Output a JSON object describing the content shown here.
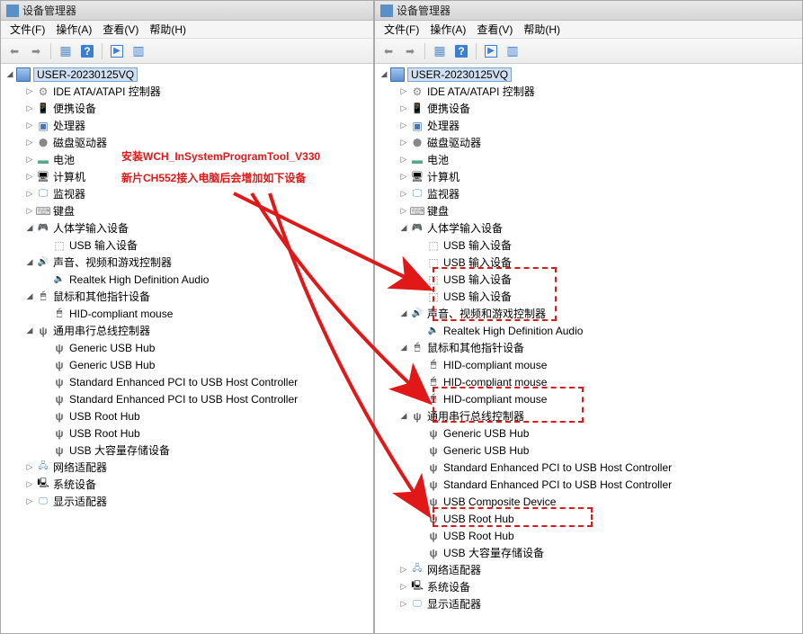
{
  "window_title": "设备管理器",
  "menu": {
    "file": "文件(F)",
    "action": "操作(A)",
    "view": "查看(V)",
    "help": "帮助(H)"
  },
  "root_name": "USER-20230125VQ",
  "annotation": {
    "line1": "安装WCH_InSystemProgramTool_V330",
    "line2": "新片CH552接入电脑后会增加如下设备"
  },
  "left_tree": [
    {
      "label": "IDE ATA/ATAPI 控制器",
      "icon": "ic-ide",
      "exp": "closed",
      "indent": 1
    },
    {
      "label": "便携设备",
      "icon": "ic-portable",
      "exp": "closed",
      "indent": 1
    },
    {
      "label": "处理器",
      "icon": "ic-cpu",
      "exp": "closed",
      "indent": 1
    },
    {
      "label": "磁盘驱动器",
      "icon": "ic-disk",
      "exp": "closed",
      "indent": 1
    },
    {
      "label": "电池",
      "icon": "ic-battery",
      "exp": "closed",
      "indent": 1
    },
    {
      "label": "计算机",
      "icon": "ic-pc",
      "exp": "closed",
      "indent": 1
    },
    {
      "label": "监视器",
      "icon": "ic-monitor",
      "exp": "closed",
      "indent": 1
    },
    {
      "label": "键盘",
      "icon": "ic-keyboard",
      "exp": "closed",
      "indent": 1
    },
    {
      "label": "人体学输入设备",
      "icon": "ic-hid",
      "exp": "open",
      "indent": 1
    },
    {
      "label": "USB 输入设备",
      "icon": "ic-usbinput",
      "exp": "none",
      "indent": 2
    },
    {
      "label": "声音、视频和游戏控制器",
      "icon": "ic-audio",
      "exp": "open",
      "indent": 1
    },
    {
      "label": "Realtek High Definition Audio",
      "icon": "ic-speaker",
      "exp": "none",
      "indent": 2
    },
    {
      "label": "鼠标和其他指针设备",
      "icon": "ic-mouse",
      "exp": "open",
      "indent": 1
    },
    {
      "label": "HID-compliant mouse",
      "icon": "ic-mouse",
      "exp": "none",
      "indent": 2
    },
    {
      "label": "通用串行总线控制器",
      "icon": "ic-usb",
      "exp": "open",
      "indent": 1
    },
    {
      "label": "Generic USB Hub",
      "icon": "ic-usb",
      "exp": "none",
      "indent": 2
    },
    {
      "label": "Generic USB Hub",
      "icon": "ic-usb",
      "exp": "none",
      "indent": 2
    },
    {
      "label": "Standard Enhanced PCI to USB Host Controller",
      "icon": "ic-usb",
      "exp": "none",
      "indent": 2
    },
    {
      "label": "Standard Enhanced PCI to USB Host Controller",
      "icon": "ic-usb",
      "exp": "none",
      "indent": 2
    },
    {
      "label": "USB Root Hub",
      "icon": "ic-usb",
      "exp": "none",
      "indent": 2
    },
    {
      "label": "USB Root Hub",
      "icon": "ic-usb",
      "exp": "none",
      "indent": 2
    },
    {
      "label": "USB 大容量存储设备",
      "icon": "ic-usb",
      "exp": "none",
      "indent": 2
    },
    {
      "label": "网络适配器",
      "icon": "ic-net",
      "exp": "closed",
      "indent": 1
    },
    {
      "label": "系统设备",
      "icon": "ic-sys",
      "exp": "closed",
      "indent": 1
    },
    {
      "label": "显示适配器",
      "icon": "ic-display",
      "exp": "closed",
      "indent": 1
    }
  ],
  "right_tree": [
    {
      "label": "IDE ATA/ATAPI 控制器",
      "icon": "ic-ide",
      "exp": "closed",
      "indent": 1
    },
    {
      "label": "便携设备",
      "icon": "ic-portable",
      "exp": "closed",
      "indent": 1
    },
    {
      "label": "处理器",
      "icon": "ic-cpu",
      "exp": "closed",
      "indent": 1
    },
    {
      "label": "磁盘驱动器",
      "icon": "ic-disk",
      "exp": "closed",
      "indent": 1
    },
    {
      "label": "电池",
      "icon": "ic-battery",
      "exp": "closed",
      "indent": 1
    },
    {
      "label": "计算机",
      "icon": "ic-pc",
      "exp": "closed",
      "indent": 1
    },
    {
      "label": "监视器",
      "icon": "ic-monitor",
      "exp": "closed",
      "indent": 1
    },
    {
      "label": "键盘",
      "icon": "ic-keyboard",
      "exp": "closed",
      "indent": 1
    },
    {
      "label": "人体学输入设备",
      "icon": "ic-hid",
      "exp": "open",
      "indent": 1
    },
    {
      "label": "USB 输入设备",
      "icon": "ic-usbinput",
      "exp": "none",
      "indent": 2
    },
    {
      "label": "USB 输入设备",
      "icon": "ic-usbinput",
      "exp": "none",
      "indent": 2
    },
    {
      "label": "USB 输入设备",
      "icon": "ic-usbinput",
      "exp": "none",
      "indent": 2
    },
    {
      "label": "USB 输入设备",
      "icon": "ic-usbinput",
      "exp": "none",
      "indent": 2
    },
    {
      "label": "声音、视频和游戏控制器",
      "icon": "ic-audio",
      "exp": "open",
      "indent": 1
    },
    {
      "label": "Realtek High Definition Audio",
      "icon": "ic-speaker",
      "exp": "none",
      "indent": 2
    },
    {
      "label": "鼠标和其他指针设备",
      "icon": "ic-mouse",
      "exp": "open",
      "indent": 1
    },
    {
      "label": "HID-compliant mouse",
      "icon": "ic-mouse",
      "exp": "none",
      "indent": 2
    },
    {
      "label": "HID-compliant mouse",
      "icon": "ic-mouse",
      "exp": "none",
      "indent": 2
    },
    {
      "label": "HID-compliant mouse",
      "icon": "ic-mouse",
      "exp": "none",
      "indent": 2
    },
    {
      "label": "通用串行总线控制器",
      "icon": "ic-usb",
      "exp": "open",
      "indent": 1
    },
    {
      "label": "Generic USB Hub",
      "icon": "ic-usb",
      "exp": "none",
      "indent": 2
    },
    {
      "label": "Generic USB Hub",
      "icon": "ic-usb",
      "exp": "none",
      "indent": 2
    },
    {
      "label": "Standard Enhanced PCI to USB Host Controller",
      "icon": "ic-usb",
      "exp": "none",
      "indent": 2
    },
    {
      "label": "Standard Enhanced PCI to USB Host Controller",
      "icon": "ic-usb",
      "exp": "none",
      "indent": 2
    },
    {
      "label": "USB Composite Device",
      "icon": "ic-usb",
      "exp": "none",
      "indent": 2
    },
    {
      "label": "USB Root Hub",
      "icon": "ic-usb",
      "exp": "none",
      "indent": 2
    },
    {
      "label": "USB Root Hub",
      "icon": "ic-usb",
      "exp": "none",
      "indent": 2
    },
    {
      "label": "USB 大容量存储设备",
      "icon": "ic-usb",
      "exp": "none",
      "indent": 2
    },
    {
      "label": "网络适配器",
      "icon": "ic-net",
      "exp": "closed",
      "indent": 1
    },
    {
      "label": "系统设备",
      "icon": "ic-sys",
      "exp": "closed",
      "indent": 1
    },
    {
      "label": "显示适配器",
      "icon": "ic-display",
      "exp": "closed",
      "indent": 1
    }
  ]
}
